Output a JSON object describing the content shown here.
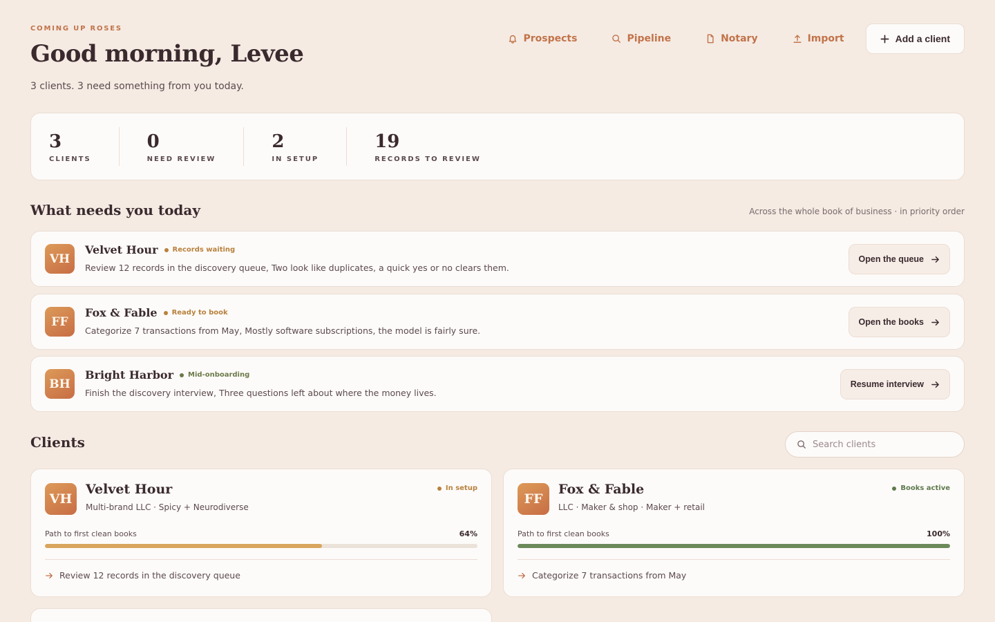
{
  "header": {
    "eyebrow": "COMING UP ROSES",
    "greeting": "Good morning, Levee",
    "summary": "3 clients. 3 need something from you today."
  },
  "nav": {
    "links": [
      {
        "label": "Prospects",
        "icon": "bell-icon"
      },
      {
        "label": "Pipeline",
        "icon": "search-icon"
      },
      {
        "label": "Notary",
        "icon": "document-icon"
      },
      {
        "label": "Import",
        "icon": "upload-icon"
      }
    ],
    "add_client_label": "Add a client"
  },
  "stats": [
    {
      "value": "3",
      "label": "CLIENTS"
    },
    {
      "value": "0",
      "label": "NEED REVIEW"
    },
    {
      "value": "2",
      "label": "IN SETUP"
    },
    {
      "value": "19",
      "label": "RECORDS TO REVIEW"
    }
  ],
  "today": {
    "title": "What needs you today",
    "note": "Across the whole book of business · in priority order",
    "tasks": [
      {
        "initials": "VH",
        "name": "Velvet Hour",
        "status": "Records waiting",
        "status_color": "#b8813e",
        "description": "Review 12 records in the discovery queue, Two look like duplicates, a quick yes or no clears them.",
        "action": "Open the queue"
      },
      {
        "initials": "FF",
        "name": "Fox & Fable",
        "status": "Ready to book",
        "status_color": "#b8813e",
        "description": "Categorize 7 transactions from May, Mostly software subscriptions, the model is fairly sure.",
        "action": "Open the books"
      },
      {
        "initials": "BH",
        "name": "Bright Harbor",
        "status": "Mid-onboarding",
        "status_color": "#6a7a4a",
        "description": "Finish the discovery interview, Three questions left about where the money lives.",
        "action": "Resume interview"
      }
    ]
  },
  "clients": {
    "title": "Clients",
    "search_placeholder": "Search clients",
    "cards": [
      {
        "initials": "VH",
        "name": "Velvet Hour",
        "subtitle": "Multi-brand LLC · Spicy + Neurodiverse",
        "status": "In setup",
        "status_color": "#b8813e",
        "progress_label": "Path to first clean books",
        "progress_text": "64%",
        "progress": 0.64,
        "progress_color": "#d9a55e",
        "next_action": "Review 12 records in the discovery queue"
      },
      {
        "initials": "FF",
        "name": "Fox & Fable",
        "subtitle": "LLC · Maker & shop · Maker + retail",
        "status": "Books active",
        "status_color": "#5e7a4e",
        "progress_label": "Path to first clean books",
        "progress_text": "100%",
        "progress": 1.0,
        "progress_color": "#6c8a5a",
        "next_action": "Categorize 7 transactions from May"
      }
    ]
  }
}
